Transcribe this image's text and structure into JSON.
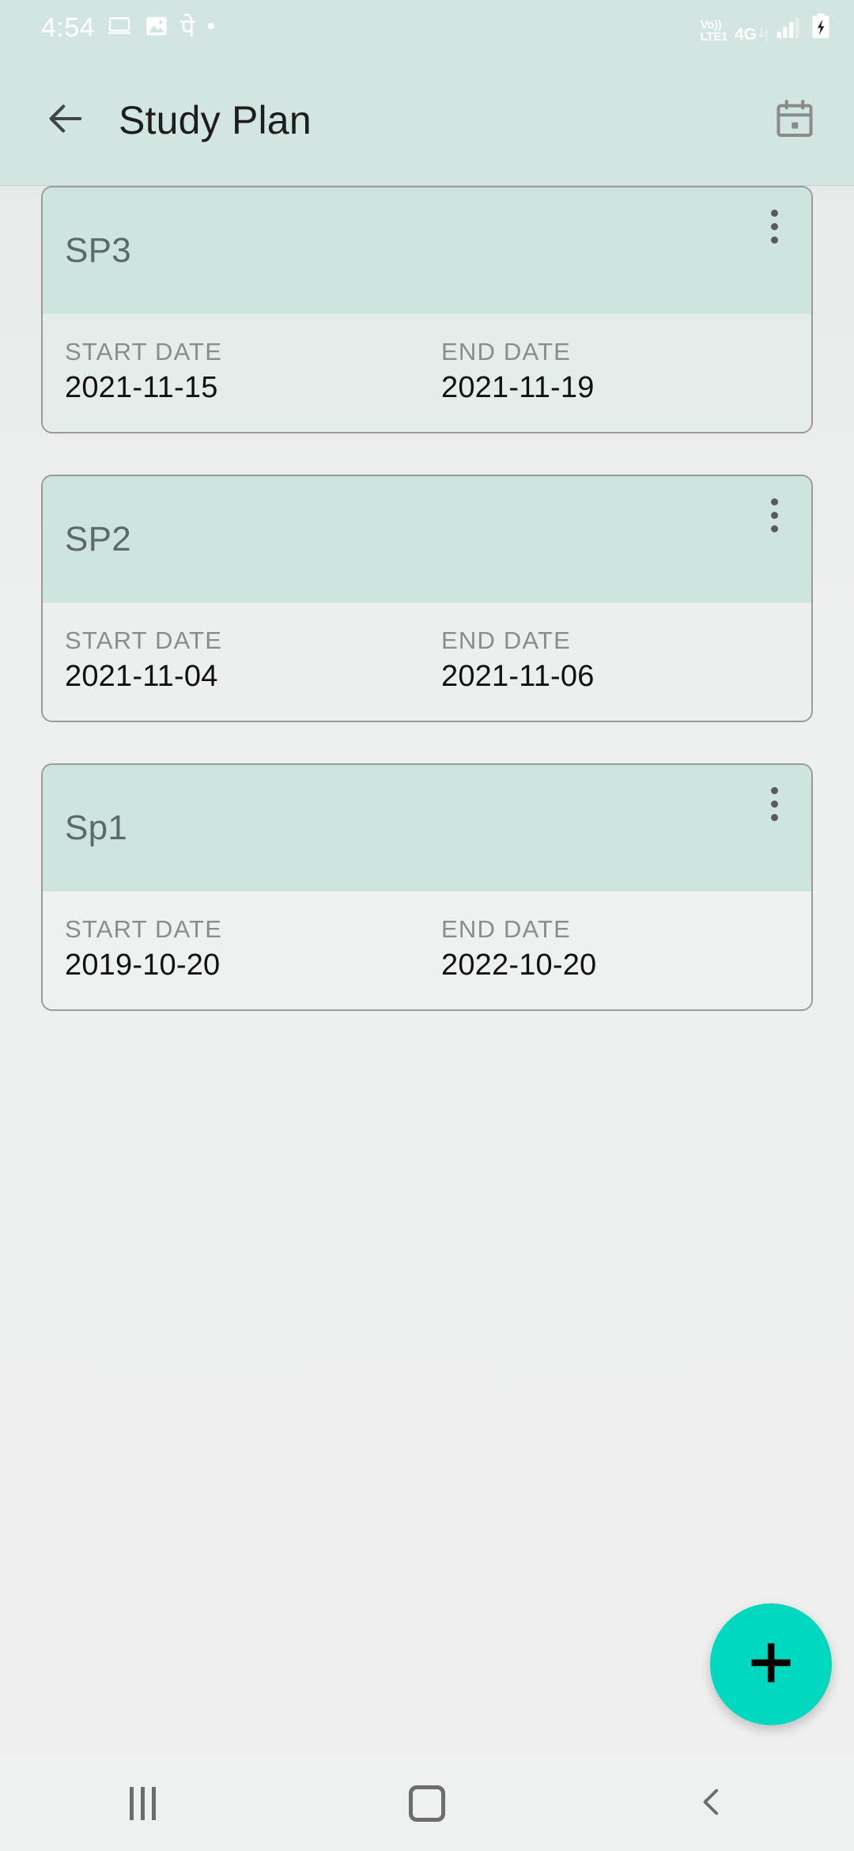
{
  "status_bar": {
    "time": "4:54",
    "left_icons": [
      "laptop-icon",
      "image-icon",
      "devanagari-glyph",
      "dot-icon"
    ],
    "devanagari_glyph": "पे",
    "volte_label": "Vo))",
    "lte_label": "LTE1",
    "network_label": "4G",
    "right_icons": [
      "data-arrows-icon",
      "signal-bars-icon",
      "battery-charging-icon"
    ]
  },
  "app_bar": {
    "back_icon": "arrow-left-icon",
    "title": "Study Plan",
    "calendar_icon": "calendar-icon"
  },
  "cards": [
    {
      "title": "SP3",
      "menu_icon": "overflow-menu-icon",
      "start_label": "START DATE",
      "start_value": "2021-11-15",
      "end_label": "END DATE",
      "end_value": "2021-11-19"
    },
    {
      "title": "SP2",
      "menu_icon": "overflow-menu-icon",
      "start_label": "START DATE",
      "start_value": "2021-11-04",
      "end_label": "END DATE",
      "end_value": "2021-11-06"
    },
    {
      "title": "Sp1",
      "menu_icon": "overflow-menu-icon",
      "start_label": "START DATE",
      "start_value": "2019-10-20",
      "end_label": "END DATE",
      "end_value": "2022-10-20"
    }
  ],
  "fab": {
    "icon": "plus-icon",
    "color": "#00d9c0"
  },
  "nav_bar": {
    "recents_icon": "recents-icon",
    "home_icon": "home-icon",
    "back_icon": "back-chevron-icon"
  },
  "colors": {
    "app_bar_bg": "#d2e5e0",
    "card_header_bg": "#cee4de",
    "card_body_bg": "#eff0f0",
    "page_bg": "#efefef",
    "accent": "#00d9c0"
  }
}
